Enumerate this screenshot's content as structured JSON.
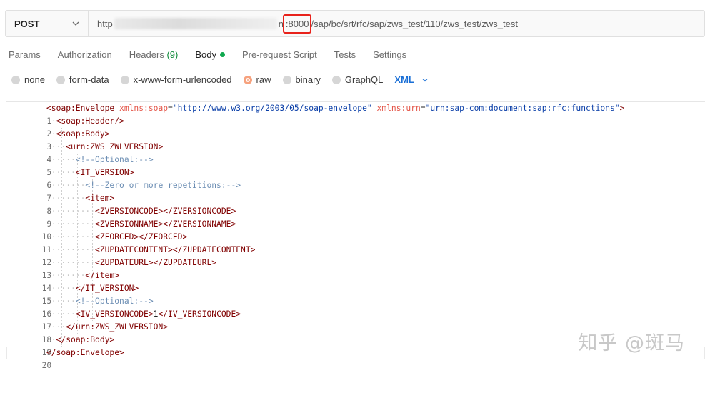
{
  "request": {
    "method": "POST",
    "url_prefix": "http",
    "url_mid": "n",
    "url_port": ":8000",
    "url_path": "/sap/bc/srt/rfc/sap/zws_test/110/zws_test/zws_test"
  },
  "tabs": [
    {
      "label": "Params"
    },
    {
      "label": "Authorization"
    },
    {
      "label": "Headers",
      "count": "(9)"
    },
    {
      "label": "Body"
    },
    {
      "label": "Pre-request Script"
    },
    {
      "label": "Tests"
    },
    {
      "label": "Settings"
    }
  ],
  "body_types": [
    "none",
    "form-data",
    "x-www-form-urlencoded",
    "raw",
    "binary",
    "GraphQL"
  ],
  "body_selected": "raw",
  "format": "XML",
  "line_numbers": [
    "1",
    "2",
    "3",
    "4",
    "5",
    "6",
    "7",
    "8",
    "9",
    "10",
    "11",
    "12",
    "13",
    "14",
    "15",
    "16",
    "17",
    "18",
    "19",
    "20"
  ],
  "code": {
    "l1_tag_open": "<soap:Envelope",
    "l1_attr1": "xmlns:soap",
    "l1_val1": "\"http://www.w3.org/2003/05/soap-envelope\"",
    "l1_attr2": "xmlns:urn",
    "l1_val2": "\"urn:sap-com:document:sap:rfc:functions\"",
    "l1_tag_close": ">",
    "l2": "<soap:Header/>",
    "l3": "<soap:Body>",
    "l4": "<urn:ZWS_ZWLVERSION>",
    "l5": "<!--Optional:-->",
    "l6": "<IT_VERSION>",
    "l7": "<!--Zero or more repetitions:-->",
    "l8": "<item>",
    "l9": "<ZVERSIONCODE></ZVERSIONCODE>",
    "l10": "<ZVERSIONNAME></ZVERSIONNAME>",
    "l11": "<ZFORCED></ZFORCED>",
    "l12": "<ZUPDATECONTENT></ZUPDATECONTENT>",
    "l13": "<ZUPDATEURL></ZUPDATEURL>",
    "l14": "</item>",
    "l15": "</IT_VERSION>",
    "l16": "<!--Optional:-->",
    "l17_open": "<IV_VERSIONCODE>",
    "l17_text": "1",
    "l17_close": "</IV_VERSIONCODE>",
    "l18": "</urn:ZWS_ZWLVERSION>",
    "l19": "</soap:Body>",
    "l20": "</soap:Envelope>"
  },
  "watermark": "知乎 @斑马",
  "colors": {
    "accent_green": "#10a84f",
    "radio_checked": "#f26b3a",
    "format_link": "#1a6fd6",
    "highlight_box": "#e8221b"
  }
}
